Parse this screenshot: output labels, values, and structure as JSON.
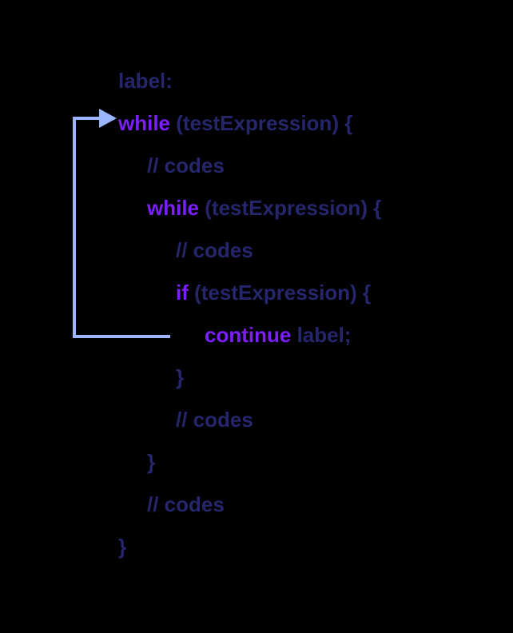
{
  "lines": {
    "l1": {
      "label": "label:"
    },
    "l2": {
      "while": "while ",
      "rest": "(testExpression) {"
    },
    "l3": {
      "comment": "// codes"
    },
    "l4": {
      "while": "while ",
      "rest": "(testExpression) {"
    },
    "l5": {
      "comment": "// codes"
    },
    "l6": {
      "if": "if ",
      "rest": "(testExpression) {"
    },
    "l7": {
      "continue": "continue ",
      "label": "label;"
    },
    "l8": {
      "brace": "}"
    },
    "l9": {
      "comment": "// codes"
    },
    "l10": {
      "brace": "}"
    },
    "l11": {
      "comment": "// codes"
    },
    "l12": {
      "brace": "}"
    }
  }
}
